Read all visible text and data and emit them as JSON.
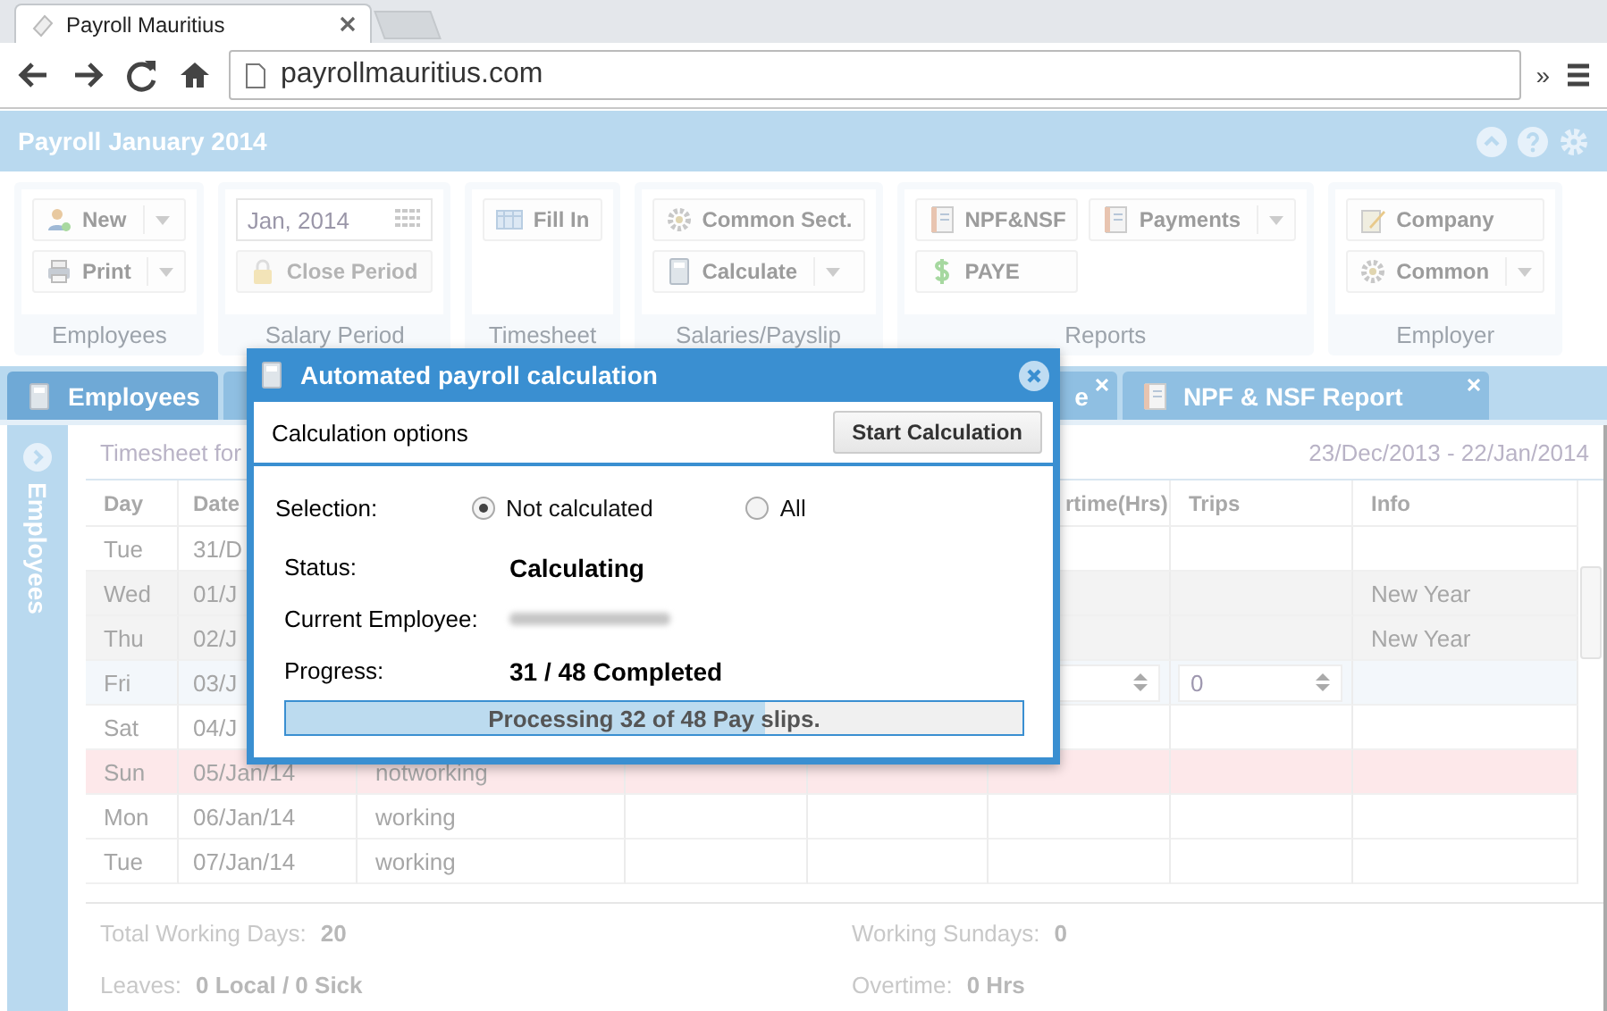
{
  "browser": {
    "tab_title": "Payroll Mauritius",
    "url": "payrollmauritius.com",
    "overflow": "»"
  },
  "app": {
    "title": "Payroll January 2014"
  },
  "ribbon": [
    {
      "label": "Employees",
      "buttons": [
        {
          "kind": "split",
          "label": "New",
          "disabled": false
        },
        {
          "kind": "split",
          "label": "Print",
          "disabled": false
        }
      ]
    },
    {
      "label": "Salary Period",
      "buttons": [
        {
          "kind": "date",
          "label": "Jan, 2014"
        },
        {
          "kind": "plain",
          "label": "Close Period",
          "disabled": true
        }
      ]
    },
    {
      "label": "Timesheet",
      "buttons": [
        {
          "kind": "plain",
          "label": "Fill In",
          "disabled": false
        }
      ]
    },
    {
      "label": "Salaries/Payslip",
      "buttons": [
        {
          "kind": "plain",
          "label": "Common Sect.",
          "disabled": false
        },
        {
          "kind": "split",
          "label": "Calculate",
          "disabled": false
        }
      ]
    },
    {
      "label": "Reports",
      "buttons": [
        {
          "kind": "plain",
          "label": "NPF&NSF",
          "disabled": false
        },
        {
          "kind": "plain",
          "label": "PAYE",
          "disabled": false
        },
        {
          "kind": "split",
          "label": "Payments",
          "disabled": false
        }
      ]
    },
    {
      "label": "Employer",
      "buttons": [
        {
          "kind": "plain",
          "label": "Company",
          "disabled": false
        },
        {
          "kind": "split",
          "label": "Common",
          "disabled": false
        }
      ]
    }
  ],
  "tabs": [
    {
      "label": "Employees",
      "selected": true,
      "closable": false
    },
    {
      "label": "e",
      "selected": false,
      "closable": true
    },
    {
      "label": "NPF & NSF Report",
      "selected": false,
      "closable": true
    }
  ],
  "sidebar": {
    "label": "Employees"
  },
  "timesheet": {
    "title": "Timesheet for",
    "range": "23/Dec/2013 - 22/Jan/2014",
    "columns": [
      {
        "label": "Day"
      },
      {
        "label": "Date"
      },
      {},
      {},
      {},
      {
        "label": "rtime(Hrs)"
      },
      {
        "label": "Trips"
      },
      {
        "label": "Info"
      }
    ],
    "rows": [
      {
        "kind": "normal",
        "day": "Tue",
        "date": "31/D"
      },
      {
        "kind": "holiday",
        "day": "Wed",
        "date": "01/J",
        "info": "New Year"
      },
      {
        "kind": "holiday",
        "day": "Thu",
        "date": "02/J",
        "info": "New Year"
      },
      {
        "kind": "current",
        "day": "Fri",
        "date": "03/J",
        "trips": "0"
      },
      {
        "kind": "normal",
        "day": "Sat",
        "date": "04/J"
      },
      {
        "kind": "sunday",
        "day": "Sun",
        "date": "05/Jan/14",
        "status": "notworking"
      },
      {
        "kind": "normal",
        "day": "Mon",
        "date": "06/Jan/14",
        "status": "working"
      },
      {
        "kind": "normal",
        "day": "Tue",
        "date": "07/Jan/14",
        "status": "working"
      }
    ],
    "summary": [
      {
        "label": "Total Working Days:",
        "value": "20"
      },
      {
        "label": "Working Sundays:",
        "value": "0"
      },
      {
        "label": "Leaves:",
        "value": "0 Local / 0 Sick"
      },
      {
        "label": "Overtime:",
        "value": "0 Hrs"
      }
    ]
  },
  "dialog": {
    "title": "Automated payroll calculation",
    "section": "Calculation options",
    "start_button": "Start Calculation",
    "selection_label": "Selection:",
    "options": [
      {
        "label": "Not calculated",
        "selected": true
      },
      {
        "label": "All",
        "selected": false
      }
    ],
    "fields": [
      {
        "label": "Status:",
        "value": "Calculating"
      },
      {
        "label": "Current Employee:"
      },
      {
        "label": "Progress:",
        "value": "31 / 48 Completed"
      }
    ],
    "progress": {
      "level": 0.65,
      "text": "Processing 32 of 48 Pay slips."
    }
  }
}
